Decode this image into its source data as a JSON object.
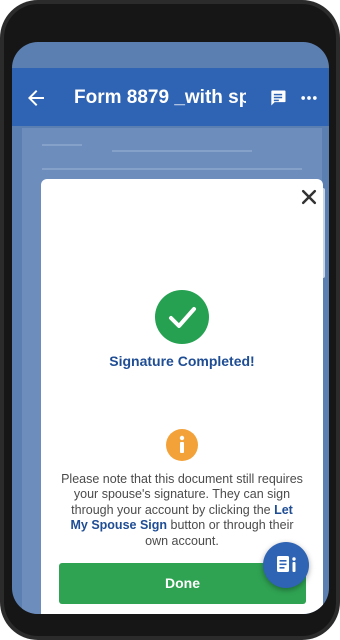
{
  "appbar": {
    "title": "Form 8879 _with sp...",
    "back_icon": "back-arrow-icon",
    "chat_icon": "chat-icon",
    "more_icon": "more-options-icon"
  },
  "modal": {
    "close_icon": "close-icon",
    "status_icon": "check-circle-icon",
    "status_title": "Signature Completed!",
    "info_icon": "info-icon",
    "message_before": "Please note that this document still requires your spouse's signature. They can sign through your account by clicking the ",
    "message_link": "Let My Spouse Sign",
    "message_after": " button or through their own account.",
    "done_button": "Done"
  },
  "fab": {
    "icon": "document-info-icon"
  },
  "colors": {
    "primary": "#2f63b3",
    "success": "#2fa352",
    "warning": "#f3a23a",
    "link": "#1f4d94"
  }
}
